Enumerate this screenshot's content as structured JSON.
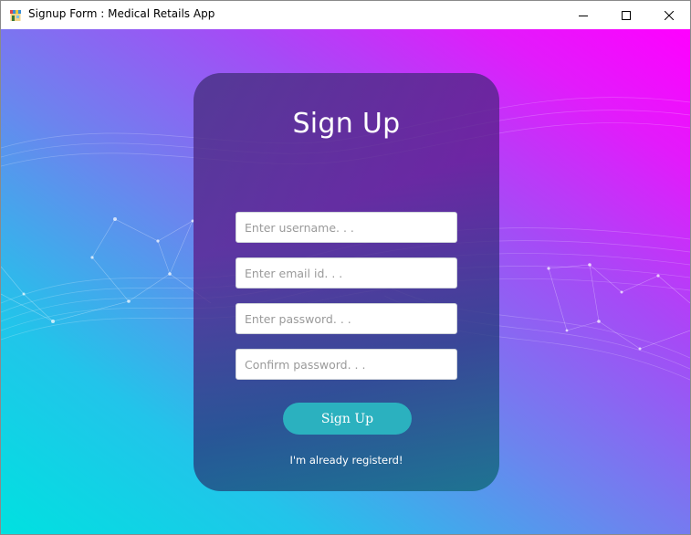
{
  "window": {
    "title": "Signup Form : Medical Retails App",
    "controls": {
      "minimize": "minimize",
      "maximize": "maximize",
      "close": "close"
    }
  },
  "form": {
    "heading": "Sign Up",
    "fields": {
      "username_placeholder": "Enter username. . .",
      "email_placeholder": "Enter email id. . .",
      "password_placeholder": "Enter password. . .",
      "confirm_placeholder": "Confirm password. . ."
    },
    "submit_label": "Sign Up",
    "login_link": "I'm already registerd!"
  },
  "colors": {
    "gradient_start": "#00e1e0",
    "gradient_end": "#ff00ff",
    "button": "#2bb1bf",
    "card": "#4a3a8a"
  }
}
